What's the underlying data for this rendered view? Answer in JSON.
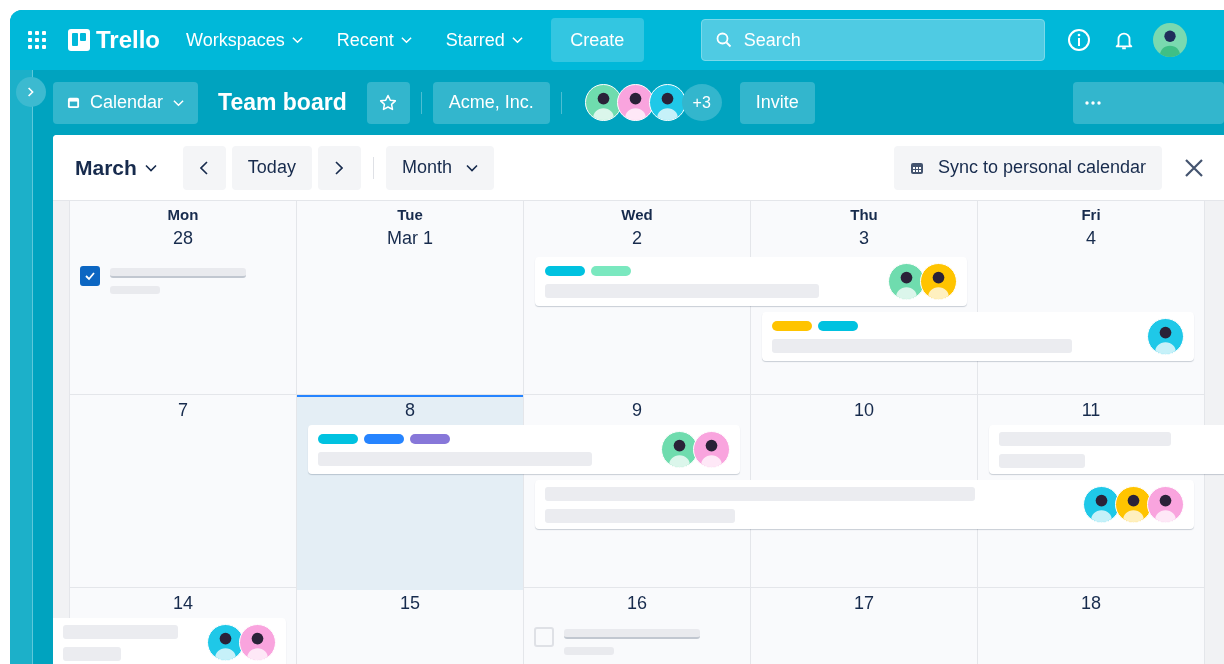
{
  "top_bar": {
    "logo": "Trello",
    "nav": [
      {
        "label": "Workspaces"
      },
      {
        "label": "Recent"
      },
      {
        "label": "Starred"
      }
    ],
    "create": "Create",
    "search": {
      "placeholder": "Search"
    }
  },
  "board_bar": {
    "view": "Calendar",
    "title": "Team board",
    "starred": false,
    "workspace": "Acme, Inc.",
    "members": [
      {
        "color": "#6fdcae"
      },
      {
        "color": "#f9a4de"
      },
      {
        "color": "#1fc8e8"
      }
    ],
    "more_members": "+3",
    "invite": "Invite"
  },
  "calendar": {
    "month": "March",
    "today_button": "Today",
    "view": "Month",
    "sync": "Sync to personal calendar",
    "weeks": [
      {
        "days": [
          {
            "weekday": "Mon",
            "date": "28",
            "today": false,
            "events": [
              {
                "kind": "task",
                "checked": true
              }
            ]
          },
          {
            "weekday": "Tue",
            "date": "Mar 1",
            "today": false
          },
          {
            "weekday": "Wed",
            "date": "2",
            "today": false,
            "events": [
              {
                "kind": "wide-card",
                "labels": [
                  {
                    "color": "#00c2e0"
                  },
                  {
                    "color": "#7ae8bf"
                  }
                ],
                "members": [
                  {
                    "color": "#6fdcae"
                  },
                  {
                    "color": "#ffc400"
                  }
                ],
                "continues_before": false,
                "continues_after": false
              }
            ]
          },
          {
            "weekday": "Thu",
            "date": "3",
            "today": false,
            "events": [
              {
                "kind": "wide-card",
                "labels": [
                  {
                    "color": "#ffc400"
                  },
                  {
                    "color": "#00c2e0"
                  }
                ],
                "members": [
                  {
                    "color": "#1fc8e8"
                  }
                ],
                "continues_before": false,
                "continues_after": false
              }
            ]
          },
          {
            "weekday": "Fri",
            "date": "4",
            "today": false
          }
        ]
      },
      {
        "days": [
          {
            "date": "7",
            "today": false
          },
          {
            "date": "8",
            "today": true,
            "events": [
              {
                "kind": "wide-card",
                "labels": [
                  {
                    "color": "#00c2e0"
                  },
                  {
                    "color": "#2684ff"
                  },
                  {
                    "color": "#8777d9"
                  }
                ],
                "members": [
                  {
                    "color": "#6fdcae"
                  },
                  {
                    "color": "#f9a4de"
                  }
                ],
                "continues_before": false,
                "continues_after": false
              }
            ]
          },
          {
            "date": "9",
            "today": false,
            "events": [
              {
                "kind": "long-card",
                "members": [
                  {
                    "color": "#1fc8e8"
                  },
                  {
                    "color": "#ffc400"
                  },
                  {
                    "color": "#f9a4de"
                  }
                ],
                "continues_before": false,
                "continues_after": false
              }
            ]
          },
          {
            "date": "10",
            "today": false
          },
          {
            "date": "11",
            "today": false,
            "events": [
              {
                "kind": "card",
                "continues_before": false,
                "continues_after": true
              }
            ]
          }
        ]
      },
      {
        "days": [
          {
            "date": "14",
            "today": false,
            "events": [
              {
                "kind": "card",
                "members": [
                  {
                    "color": "#1fc8e8"
                  },
                  {
                    "color": "#f9a4de"
                  }
                ],
                "continues_before": true,
                "continues_after": false
              }
            ]
          },
          {
            "date": "15",
            "today": false
          },
          {
            "date": "16",
            "today": false,
            "events": [
              {
                "kind": "task",
                "checked": false
              }
            ]
          },
          {
            "date": "17",
            "today": false
          },
          {
            "date": "18",
            "today": false
          }
        ]
      }
    ]
  }
}
